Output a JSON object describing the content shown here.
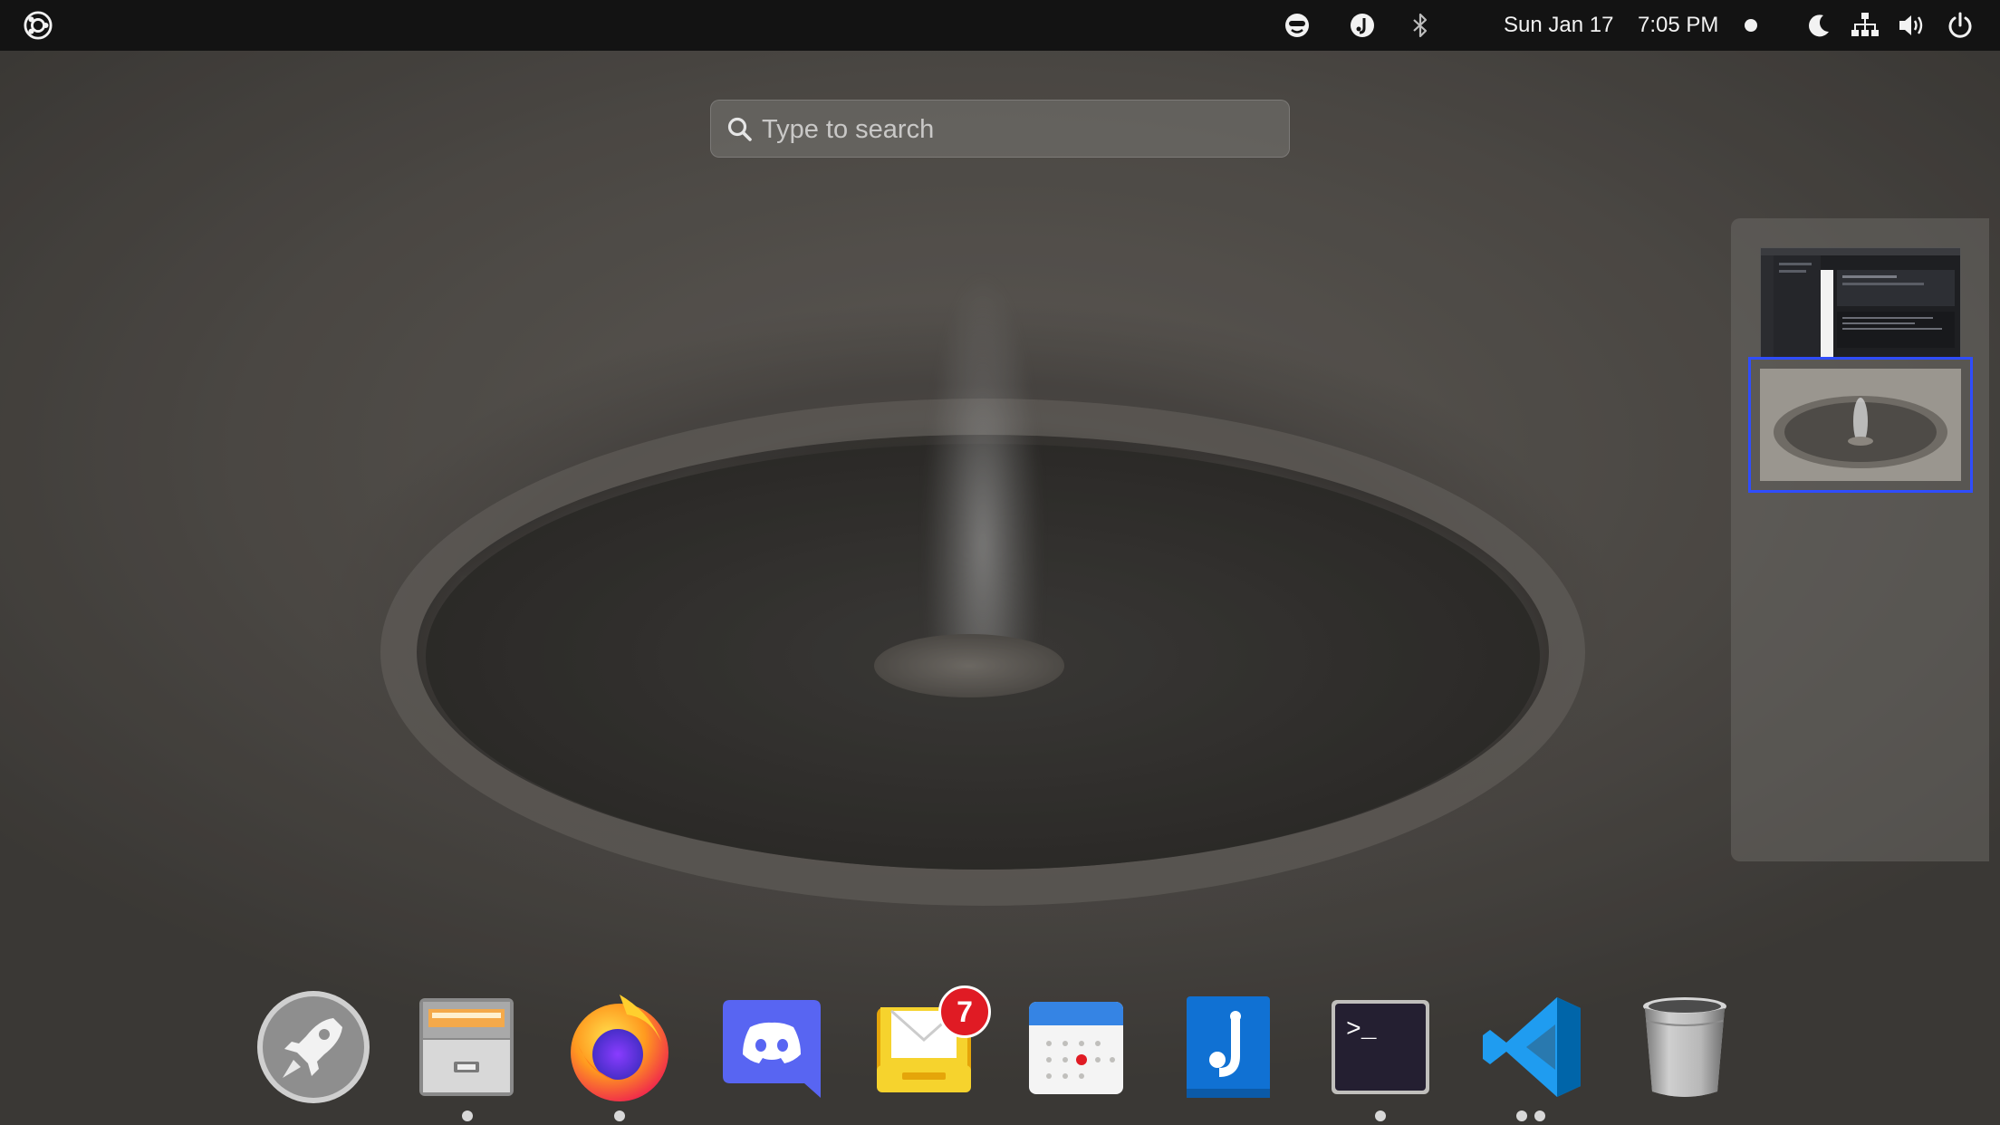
{
  "topbar": {
    "date": "Sun Jan 17",
    "time": "7:05 PM",
    "icons": [
      "ubuntu-logo-icon",
      "face-indicator-icon",
      "joplin-tray-icon",
      "bluetooth-icon",
      "notification-dot-icon",
      "night-light-icon",
      "network-icon",
      "volume-icon",
      "power-icon"
    ]
  },
  "search": {
    "placeholder": "Type to search"
  },
  "workspaces": [
    {
      "name": "workspace-1",
      "active": false
    },
    {
      "name": "workspace-2",
      "active": true
    }
  ],
  "dock": {
    "items": [
      {
        "name": "launcher",
        "running": false
      },
      {
        "name": "files",
        "running": true
      },
      {
        "name": "firefox",
        "running": true
      },
      {
        "name": "discord",
        "running": false
      },
      {
        "name": "mail",
        "running": false,
        "badge": "7"
      },
      {
        "name": "calendar",
        "running": false
      },
      {
        "name": "joplin",
        "running": false
      },
      {
        "name": "terminal",
        "running": true,
        "prompt": ">_"
      },
      {
        "name": "vscode",
        "running": true,
        "windows": 2
      },
      {
        "name": "trash",
        "running": false
      }
    ]
  },
  "colors": {
    "topbar_bg": "#131313",
    "workspace_highlight": "#2f4dff",
    "badge_red": "#e01b24",
    "discord": "#5865f2",
    "joplin": "#1071d3",
    "vscode": "#1f9cf0",
    "mail": "#f6d32d"
  }
}
